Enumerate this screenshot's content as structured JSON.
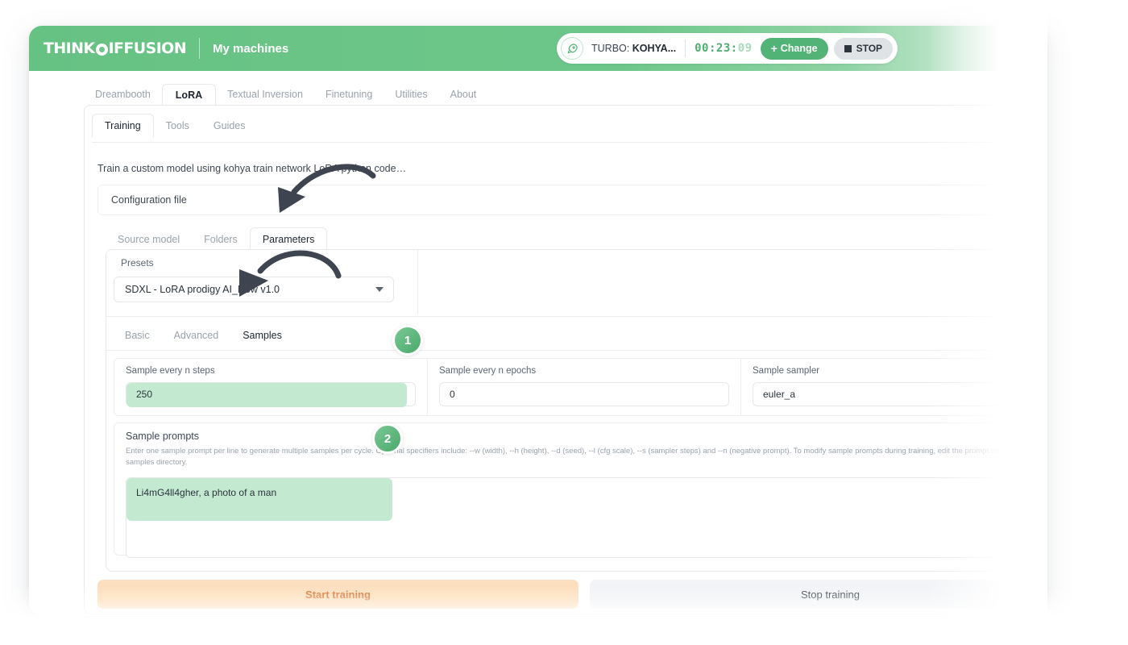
{
  "header": {
    "brand_part1": "THINK",
    "brand_part2": "IFFUSION",
    "nav_label": "My machines",
    "machine_prefix": "TURBO: ",
    "machine_name": "KOHYA...",
    "timer_main": "00:23:",
    "timer_dim": "09",
    "change_label": "Change",
    "stop_label": "STOP",
    "rocket_icon": "rocket-icon"
  },
  "main_tabs": [
    {
      "label": "Dreambooth",
      "active": false
    },
    {
      "label": "LoRA",
      "active": true
    },
    {
      "label": "Textual Inversion",
      "active": false
    },
    {
      "label": "Finetuning",
      "active": false
    },
    {
      "label": "Utilities",
      "active": false
    },
    {
      "label": "About",
      "active": false
    }
  ],
  "sub_tabs": [
    {
      "label": "Training",
      "active": true
    },
    {
      "label": "Tools",
      "active": false
    },
    {
      "label": "Guides",
      "active": false
    }
  ],
  "intro_text": "Train a custom model using kohya train network LoRA python code…",
  "config_row": {
    "label": "Configuration file",
    "arrow_icon": "collapse-left-triangle-icon"
  },
  "inner_tabs": [
    {
      "label": "Source model",
      "active": false
    },
    {
      "label": "Folders",
      "active": false
    },
    {
      "label": "Parameters",
      "active": true
    }
  ],
  "presets": {
    "label": "Presets",
    "value": "SDXL - LoRA prodigy AI_Now v1.0"
  },
  "level_tabs": [
    {
      "label": "Basic",
      "active": false
    },
    {
      "label": "Advanced",
      "active": false
    },
    {
      "label": "Samples",
      "active": true
    }
  ],
  "sample_fields": [
    {
      "label": "Sample every n steps",
      "value": "250",
      "kind": "text",
      "highlight": true
    },
    {
      "label": "Sample every n epochs",
      "value": "0",
      "kind": "text",
      "highlight": false
    },
    {
      "label": "Sample sampler",
      "value": "euler_a",
      "kind": "select",
      "highlight": false
    }
  ],
  "prompts": {
    "label": "Sample prompts",
    "help": "Enter one sample prompt per line to generate multiple samples per cycle. Optional specifiers include: --w (width), --h (height), --d (seed), --l (cfg scale), --s (sampler steps) and --n (negative prompt). To modify sample prompts during training, edit the prompt.txt file in the samples directory.",
    "value": "Li4mG4ll4gher, a photo of a man"
  },
  "buttons": {
    "start": "Start training",
    "stop": "Stop training"
  },
  "annotations": {
    "badge1": "1",
    "badge2": "2"
  },
  "colors": {
    "brand_green": "#6dc78a",
    "accent_green": "#51b375",
    "highlight_green": "#c9ecd5",
    "start_orange": "#d96a22",
    "arrow_gray": "#3f4550"
  }
}
